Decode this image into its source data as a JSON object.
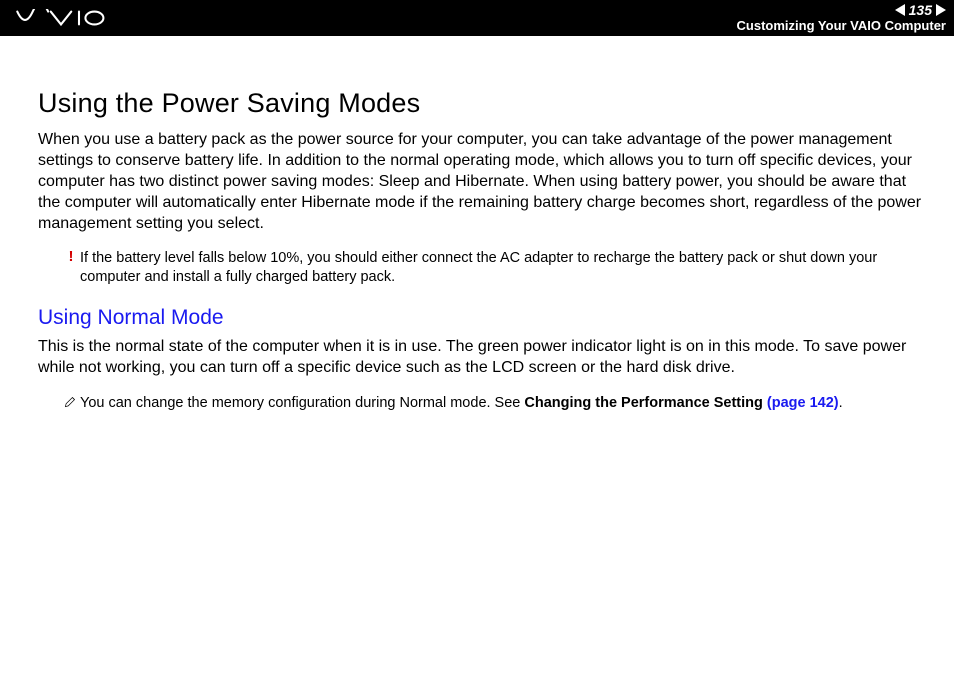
{
  "header": {
    "page_number": "135",
    "section": "Customizing Your VAIO Computer"
  },
  "body": {
    "h1": "Using the Power Saving Modes",
    "p1": "When you use a battery pack as the power source for your computer, you can take advantage of the power management settings to conserve battery life. In addition to the normal operating mode, which allows you to turn off specific devices, your computer has two distinct power saving modes: Sleep and Hibernate. When using battery power, you should be aware that the computer will automatically enter Hibernate mode if the remaining battery charge becomes short, regardless of the power management setting you select.",
    "warn_icon": "!",
    "warn_text": "If the battery level falls below 10%, you should either connect the AC adapter to recharge the battery pack or shut down your computer and install a fully charged battery pack.",
    "h2": "Using Normal Mode",
    "p2": "This is the normal state of the computer when it is in use. The green power indicator light is on in this mode. To save power while not working, you can turn off a specific device such as the LCD screen or the hard disk drive.",
    "tip_text_pre": "You can change the memory configuration during Normal mode. See ",
    "tip_ref_label": "Changing the Performance Setting ",
    "tip_ref_page": "(page 142)",
    "tip_trailing": "."
  }
}
